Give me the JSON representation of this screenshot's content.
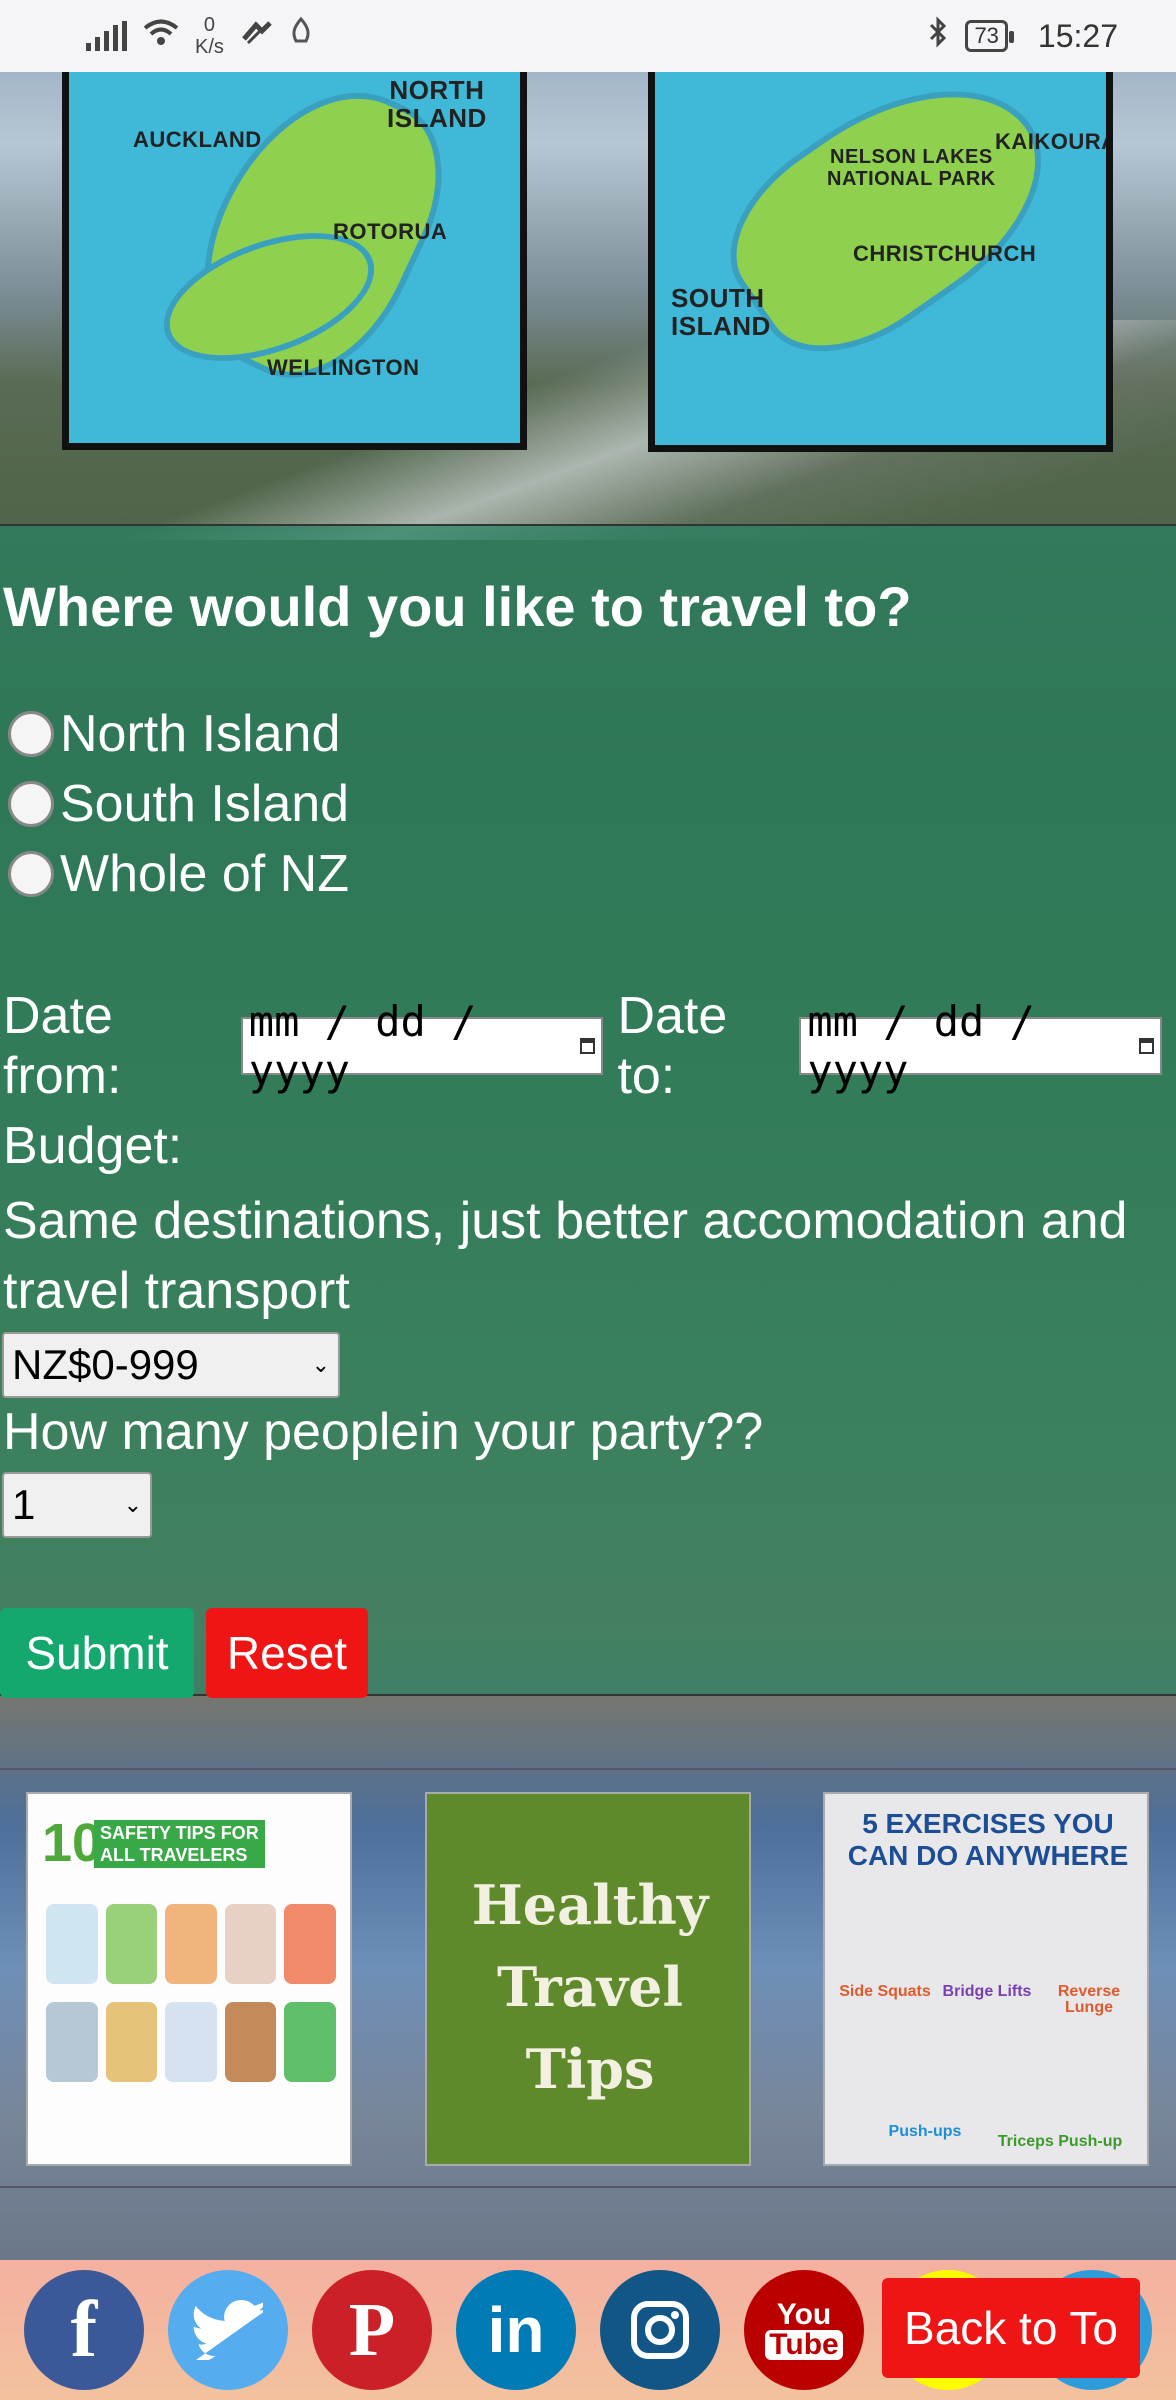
{
  "status_bar": {
    "net_speed_value": "0",
    "net_speed_unit": "K/s",
    "battery": "73",
    "time": "15:27"
  },
  "maps": {
    "north": {
      "title_line1": "NORTH",
      "title_line2": "ISLAND",
      "places": [
        "AUCKLAND",
        "ROTORUA",
        "WELLINGTON"
      ]
    },
    "south": {
      "title_line1": "SOUTH",
      "title_line2": "ISLAND",
      "places": [
        "NELSON LAKES",
        "NATIONAL PARK",
        "KAIKOURA",
        "CHRISTCHURCH"
      ]
    }
  },
  "form": {
    "question": "Where would you like to travel to?",
    "destinations": [
      "North Island",
      "South Island",
      "Whole of NZ"
    ],
    "date_from_label": "Date from:",
    "date_to_label": "Date to:",
    "date_placeholder": "mm / dd / yyyy",
    "budget_label": "Budget:",
    "budget_note": "Same destinations, just better accomodation and travel transport",
    "budget_selected": "NZ$0-999",
    "party_label": "How many peoplein your party??",
    "party_selected": "1",
    "submit_label": "Submit",
    "reset_label": "Reset"
  },
  "tips": {
    "tip1": {
      "number": "10",
      "line1": "SAFETY TIPS FOR",
      "line2": "ALL TRAVELERS"
    },
    "tip2": {
      "line1": "Healthy",
      "line2": "Travel",
      "line3": "Tips"
    },
    "tip3": {
      "line1": "5 EXERCISES YOU",
      "line2": "CAN DO ANYWHERE",
      "exercises": [
        "Side Squats",
        "Bridge Lifts",
        "Reverse Lunge",
        "Push-ups",
        "Triceps Push-up"
      ]
    }
  },
  "footer": {
    "facebook": "f",
    "twitter": "🐦",
    "pinterest": "P",
    "linkedin": "in",
    "instagram": "◎",
    "youtube_top": "You",
    "youtube_bottom": "Tube",
    "back_to_top": "Back to To"
  }
}
